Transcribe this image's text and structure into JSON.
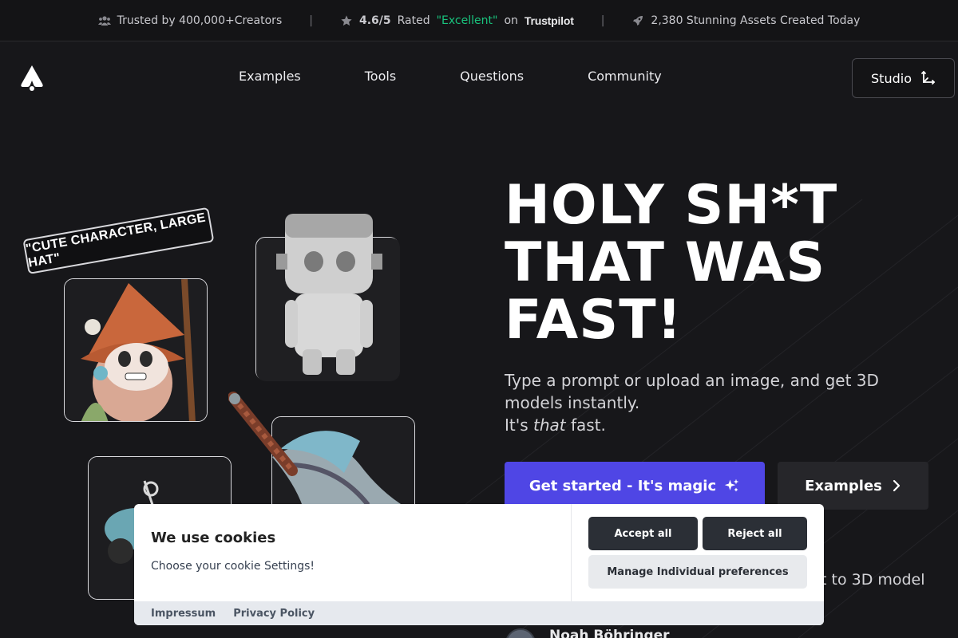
{
  "trustbar": {
    "creators": "Trusted by 400,000+Creators",
    "rating_score": "4.6/5",
    "rating_rated": "Rated",
    "rating_excellent": "\"Excellent\"",
    "rating_on": "on",
    "rating_brand": "Trustpilot",
    "assets": "2,380 Stunning Assets Created Today",
    "separator": "|"
  },
  "nav": {
    "links": [
      "Examples",
      "Tools",
      "Questions",
      "Community"
    ],
    "studio_label": "Studio"
  },
  "hero": {
    "title_lines": [
      "HOLY SH*T",
      "THAT WAS",
      "FAST!"
    ],
    "subtitle_line1": "Type a prompt or upload an image, and get 3D models instantly.",
    "subtitle_prefix": "It's ",
    "subtitle_em": "that",
    "subtitle_suffix": " fast.",
    "primary_cta": "Get started - It's magic",
    "secondary_cta": "Examples",
    "partial_text": "t to 3D model",
    "testimonial_name": "Noah Böhringer"
  },
  "showcase": {
    "prompt_tag": "\"CUTE CHARACTER, LARGE HAT\""
  },
  "cookie": {
    "title": "We use cookies",
    "description": "Choose your cookie Settings!",
    "accept_all": "Accept all",
    "reject_all": "Reject all",
    "manage": "Manage Individual preferences",
    "footer_links": [
      "Impressum",
      "Privacy Policy"
    ]
  },
  "colors": {
    "accent": "#4f46e5",
    "trustpilot_green": "#19c37d",
    "background": "#17171a"
  }
}
